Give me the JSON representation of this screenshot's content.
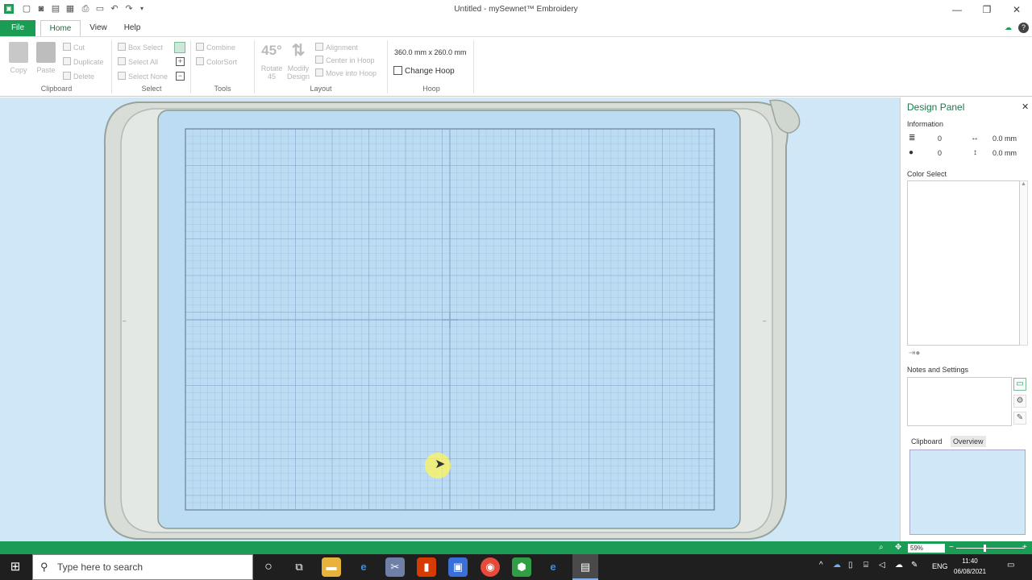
{
  "window": {
    "title": "Untitled - mySewnet™ Embroidery",
    "minimize_icon": "—",
    "restore_icon": "❐",
    "close_icon": "✕"
  },
  "quick_access": {
    "icons": [
      "app-logo-icon",
      "new-icon",
      "save-icon",
      "save-as-icon",
      "export-icon",
      "print-icon",
      "window-icon",
      "undo-icon",
      "redo-icon",
      "customize-icon"
    ]
  },
  "tabs": {
    "file": "File",
    "home": "Home",
    "view": "View",
    "help": "Help"
  },
  "ribbon": {
    "clipboard": {
      "label": "Clipboard",
      "copy": "Copy",
      "paste": "Paste",
      "cut": "Cut",
      "duplicate": "Duplicate",
      "delete": "Delete"
    },
    "select": {
      "label": "Select",
      "box_select": "Box Select",
      "select_all": "Select All",
      "select_none": "Select None"
    },
    "tools": {
      "label": "Tools",
      "combine": "Combine",
      "colorsort": "ColorSort"
    },
    "layout": {
      "label": "Layout",
      "rotate_icon_text": "45°",
      "rotate": "Rotate 45",
      "modify_design": "Modify Design",
      "alignment": "Alignment",
      "center_in_hoop": "Center in Hoop",
      "move_into_hoop": "Move into Hoop"
    },
    "hoop": {
      "label": "Hoop",
      "size": "360.0 mm x 260.0 mm",
      "change_hoop": "Change Hoop"
    }
  },
  "design_panel": {
    "title": "Design Panel",
    "close": "✕",
    "information_label": "Information",
    "stitches": "0",
    "colors": "0",
    "width": "0.0 mm",
    "height": "0.0 mm",
    "color_select_label": "Color Select",
    "notes_label": "Notes and Settings",
    "clipboard_tab": "Clipboard",
    "overview_tab": "Overview"
  },
  "statusbar": {
    "zoom": "59%",
    "zoom_level": 0.4
  },
  "taskbar": {
    "search_placeholder": "Type here to search",
    "language": "ENG",
    "time": "11:40",
    "date": "06/08/2021",
    "apps": [
      "cortana-icon",
      "task-view-icon",
      "file-explorer-icon",
      "edge-legacy-icon",
      "snipping-icon",
      "office-icon",
      "photos-icon",
      "chrome-icon",
      "app-green-icon",
      "edge-icon",
      "mysewnet-icon"
    ]
  },
  "colors": {
    "accent": "#1a9c54",
    "canvas_bg": "#d0e7f8",
    "hoop_inner": "#bcdcf4",
    "grid_line": "#8aa8cc",
    "taskbar": "#1f1f1f"
  }
}
